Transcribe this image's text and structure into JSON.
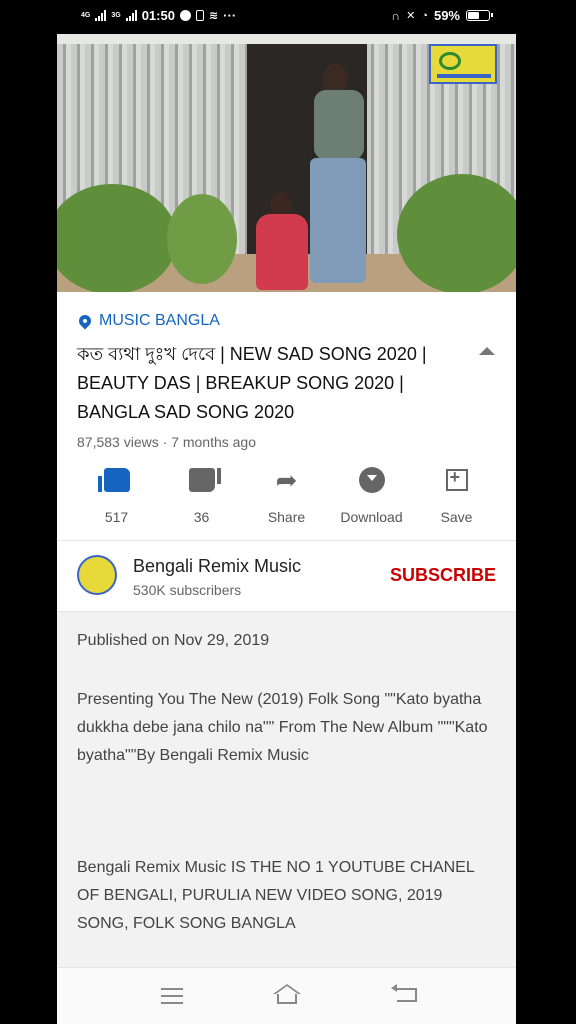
{
  "status_bar": {
    "network_1": "4G",
    "network_2": "3G",
    "time": "01:50",
    "battery": "59%",
    "battery_level": 0.59,
    "overflow": "···"
  },
  "video": {
    "thumbnail_description": "Man standing by tin house door, woman sitting on step",
    "overlay_logo": "channel-logo"
  },
  "location": {
    "label": "MUSIC BANGLA"
  },
  "title": "কত ব্যথা দুঃখ দেবে | NEW SAD SONG 2020 | BEAUTY DAS | BREAKUP SONG 2020 | BANGLA SAD SONG 2020",
  "meta": "87,583 views · 7 months ago",
  "actions": {
    "like": "517",
    "dislike": "36",
    "share": "Share",
    "download": "Download",
    "save": "Save"
  },
  "channel": {
    "name": "Bengali Remix Music",
    "subscribers": "530K subscribers",
    "subscribe_label": "SUBSCRIBE"
  },
  "description": {
    "published": "Published on Nov 29, 2019",
    "paragraph_1": "Presenting You The New (2019) Folk Song \"\"Kato byatha dukkha debe jana chilo na\"\" From The New Album \"\"\"Kato byatha\"\"By Bengali Remix Music",
    "paragraph_2": "Bengali Remix Music IS THE NO 1 YOUTUBE CHANEL OF BENGALI, PURULIA NEW VIDEO SONG, 2019 SONG, FOLK SONG BANGLA"
  },
  "colors": {
    "accent_blue": "#1565c0",
    "subscribe_red": "#cc0000"
  }
}
